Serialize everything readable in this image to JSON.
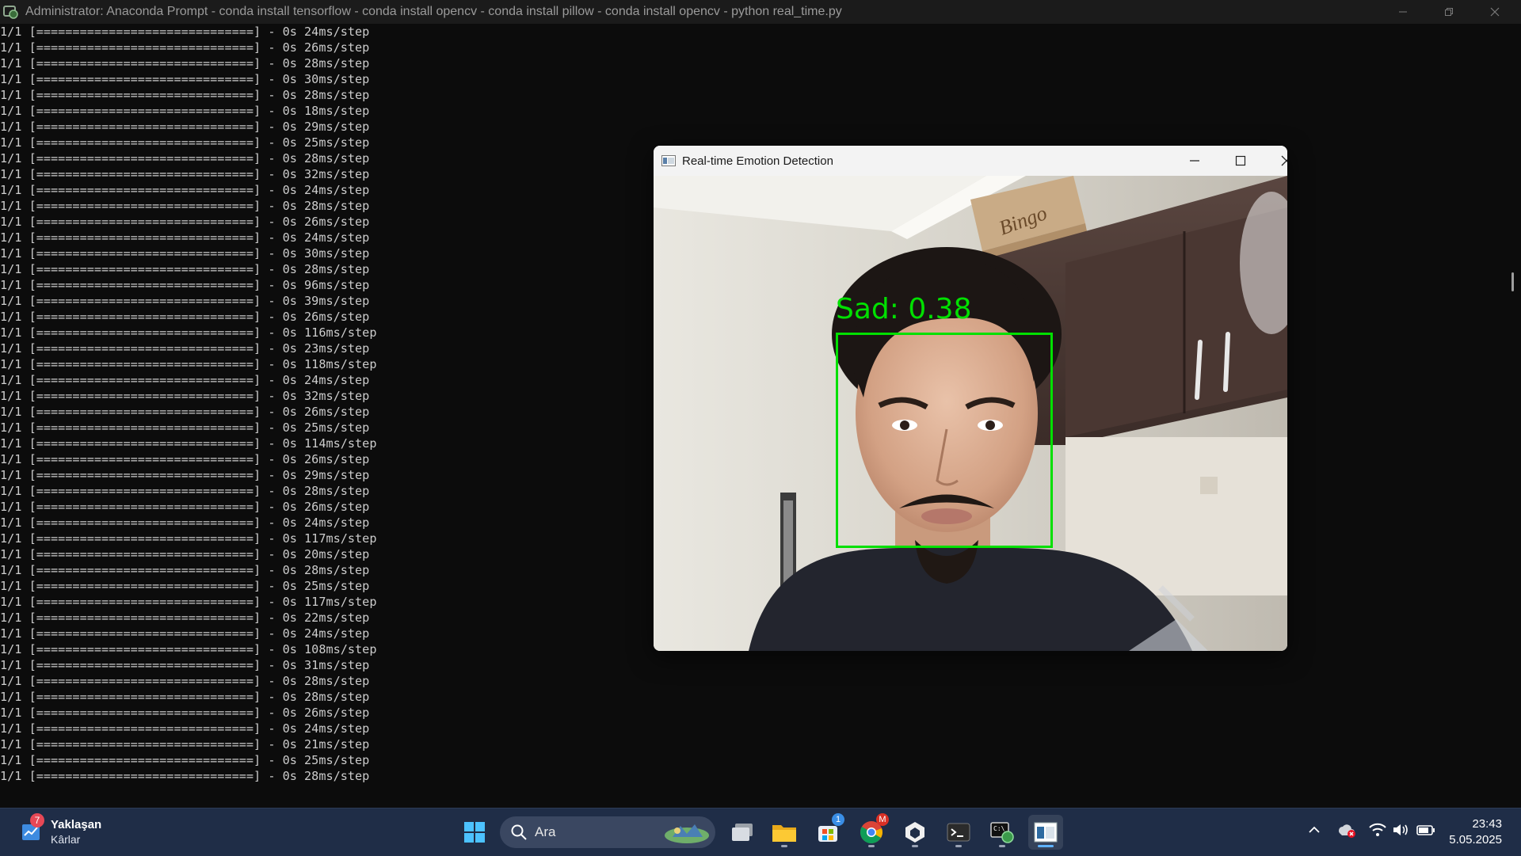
{
  "console_window": {
    "title": "Administrator: Anaconda Prompt - conda  install tensorflow - conda  install opencv - conda  install pillow - conda  install opencv - python  real_time.py",
    "lines": [
      "1/1 [==============================] - 0s 24ms/step",
      "1/1 [==============================] - 0s 26ms/step",
      "1/1 [==============================] - 0s 28ms/step",
      "1/1 [==============================] - 0s 30ms/step",
      "1/1 [==============================] - 0s 28ms/step",
      "1/1 [==============================] - 0s 18ms/step",
      "1/1 [==============================] - 0s 29ms/step",
      "1/1 [==============================] - 0s 25ms/step",
      "1/1 [==============================] - 0s 28ms/step",
      "1/1 [==============================] - 0s 32ms/step",
      "1/1 [==============================] - 0s 24ms/step",
      "1/1 [==============================] - 0s 28ms/step",
      "1/1 [==============================] - 0s 26ms/step",
      "1/1 [==============================] - 0s 24ms/step",
      "1/1 [==============================] - 0s 30ms/step",
      "1/1 [==============================] - 0s 28ms/step",
      "1/1 [==============================] - 0s 96ms/step",
      "1/1 [==============================] - 0s 39ms/step",
      "1/1 [==============================] - 0s 26ms/step",
      "1/1 [==============================] - 0s 116ms/step",
      "1/1 [==============================] - 0s 23ms/step",
      "1/1 [==============================] - 0s 118ms/step",
      "1/1 [==============================] - 0s 24ms/step",
      "1/1 [==============================] - 0s 32ms/step",
      "1/1 [==============================] - 0s 26ms/step",
      "1/1 [==============================] - 0s 25ms/step",
      "1/1 [==============================] - 0s 114ms/step",
      "1/1 [==============================] - 0s 26ms/step",
      "1/1 [==============================] - 0s 29ms/step",
      "1/1 [==============================] - 0s 28ms/step",
      "1/1 [==============================] - 0s 26ms/step",
      "1/1 [==============================] - 0s 24ms/step",
      "1/1 [==============================] - 0s 117ms/step",
      "1/1 [==============================] - 0s 20ms/step",
      "1/1 [==============================] - 0s 28ms/step",
      "1/1 [==============================] - 0s 25ms/step",
      "1/1 [==============================] - 0s 117ms/step",
      "1/1 [==============================] - 0s 22ms/step",
      "1/1 [==============================] - 0s 24ms/step",
      "1/1 [==============================] - 0s 108ms/step",
      "1/1 [==============================] - 0s 31ms/step",
      "1/1 [==============================] - 0s 28ms/step",
      "1/1 [==============================] - 0s 28ms/step",
      "1/1 [==============================] - 0s 26ms/step",
      "1/1 [==============================] - 0s 24ms/step",
      "1/1 [==============================] - 0s 21ms/step",
      "1/1 [==============================] - 0s 25ms/step",
      "1/1 [==============================] - 0s 28ms/step"
    ]
  },
  "emotion_window": {
    "title": "Real-time Emotion Detection",
    "detection_label": "Sad: 0.38",
    "box_color": "#00e000",
    "box_text": "Bingo"
  },
  "taskbar": {
    "weather": {
      "line1": "Yaklaşan",
      "line2": "Kârlar",
      "badge": "7"
    },
    "search_placeholder": "Ara",
    "store_badge": "1",
    "chrome_badge": "M",
    "clock": {
      "time": "23:43",
      "date": "5.05.2025"
    },
    "icons": [
      "windows-start-icon",
      "search-icon",
      "task-view-icon",
      "file-explorer-icon",
      "microsoft-store-icon",
      "chrome-icon",
      "app-icon",
      "terminal-icon",
      "anaconda-prompt-icon",
      "opencv-window-icon"
    ],
    "tray_icons": [
      "chevron-up-icon",
      "onedrive-error-icon",
      "wifi-icon",
      "volume-icon",
      "battery-icon"
    ]
  },
  "colors": {
    "console_bg": "#0c0c0c",
    "console_text": "#cccccc",
    "taskbar_bg": "#1f2d47",
    "accent": "#5fb3ff"
  }
}
